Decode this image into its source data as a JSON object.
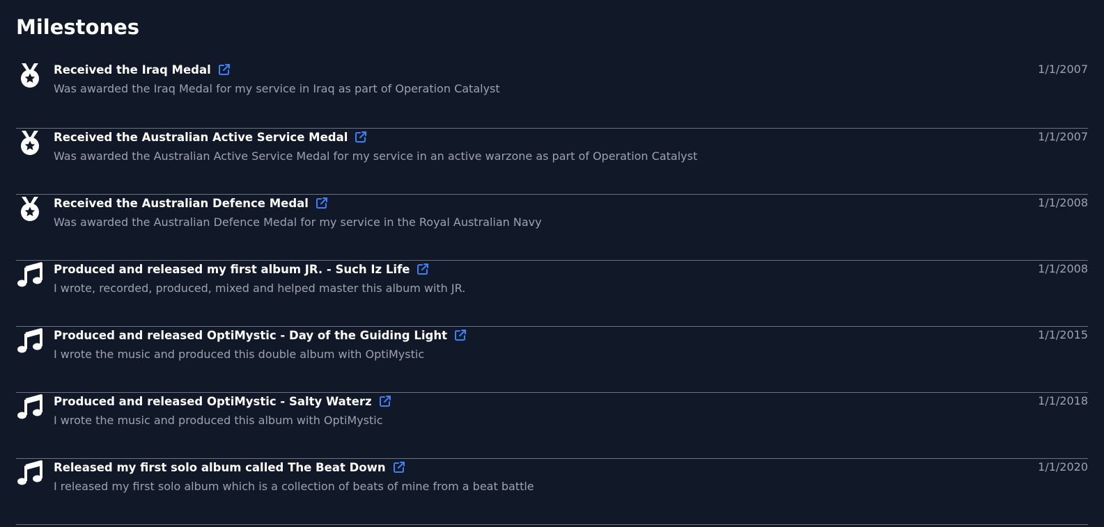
{
  "page": {
    "title": "Milestones"
  },
  "colors": {
    "background": "#111827",
    "title": "#ffffff",
    "muted": "#9ca3af",
    "link": "#3b82f6",
    "divider": "#6b7280"
  },
  "milestones": [
    {
      "icon": "medal-icon",
      "title": "Received the Iraq Medal",
      "description": "Was awarded the Iraq Medal for my service in Iraq as part of Operation Catalyst",
      "date": "1/1/2007"
    },
    {
      "icon": "medal-icon",
      "title": "Received the Australian Active Service Medal",
      "description": "Was awarded the Australian Active Service Medal for my service in an active warzone as part of Operation Catalyst",
      "date": "1/1/2007"
    },
    {
      "icon": "medal-icon",
      "title": "Received the Australian Defence Medal",
      "description": "Was awarded the Australian Defence Medal for my service in the Royal Australian Navy",
      "date": "1/1/2008"
    },
    {
      "icon": "music-note-icon",
      "title": "Produced and released my first album JR. - Such Iz Life",
      "description": "I wrote, recorded, produced, mixed and helped master this album with JR.",
      "date": "1/1/2008"
    },
    {
      "icon": "music-note-icon",
      "title": "Produced and released OptiMystic - Day of the Guiding Light",
      "description": "I wrote the music and produced this double album with OptiMystic",
      "date": "1/1/2015"
    },
    {
      "icon": "music-note-icon",
      "title": "Produced and released OptiMystic - Salty Waterz",
      "description": "I wrote the music and produced this album with OptiMystic",
      "date": "1/1/2018"
    },
    {
      "icon": "music-note-icon",
      "title": "Released my first solo album called The Beat Down",
      "description": "I released my first solo album which is a collection of beats of mine from a beat battle",
      "date": "1/1/2020"
    }
  ]
}
